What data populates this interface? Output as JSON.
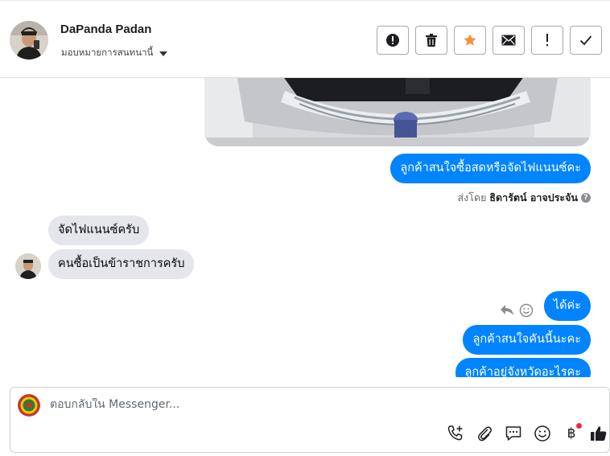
{
  "header": {
    "contact_name": "DaPanda Padan",
    "assign_label": "มอบหมายการสนทนานี้",
    "actions": [
      "mark-spam",
      "delete",
      "star",
      "mark-unread",
      "follow-up",
      "done"
    ]
  },
  "conversation": {
    "messages": [
      {
        "direction": "out",
        "text": "ลูกค้าสนใจซื้อสดหรือจัดไฟแนนซ์คะ"
      },
      {
        "direction": "in",
        "text": "จัดไฟแนนซ์ครับ"
      },
      {
        "direction": "in",
        "text": "คนซื้อเป็นข้าราชการครับ"
      },
      {
        "direction": "out",
        "text": "ได้ค่ะ"
      },
      {
        "direction": "out",
        "text": "ลูกค้าสนใจคันนี้นะคะ"
      },
      {
        "direction": "out",
        "text": "ลูกค้าอยู่จังหวัดอะไรคะ"
      }
    ],
    "sent_by_prefix": "ส่งโดย",
    "sent_by_name": "ธิดารัตน์ อาจประจัน",
    "help_icon_text": "?"
  },
  "composer": {
    "placeholder": "ตอบกลับใน Messenger...",
    "currency_symbol": "฿",
    "tools": [
      "call-add-icon",
      "paperclip-icon",
      "saved-reply-icon",
      "emoji-icon",
      "baht-payment-icon",
      "thumbs-up-icon"
    ]
  },
  "colors": {
    "outgoing_bubble": "#0084ff",
    "incoming_bubble": "#e4e6eb",
    "star_accent": "#f7923a",
    "notification_dot": "#f02849"
  }
}
